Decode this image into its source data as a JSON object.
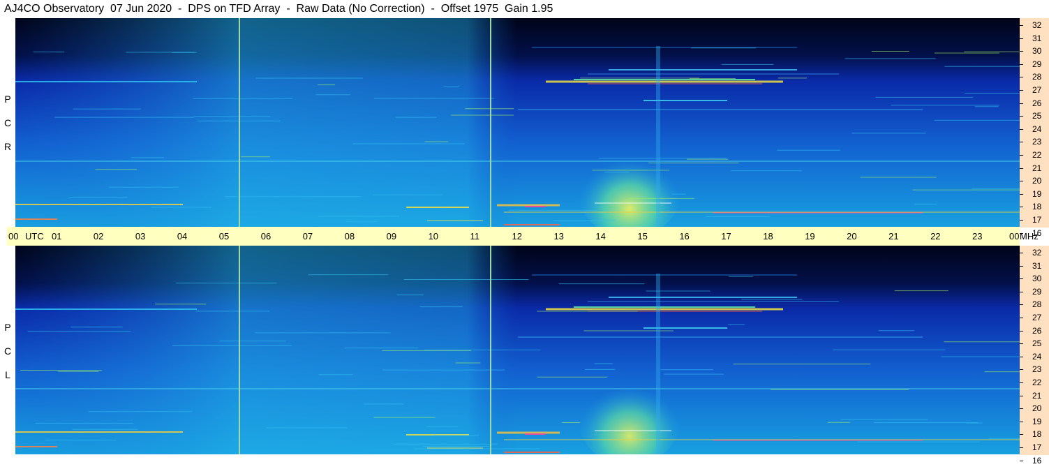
{
  "title": "AJ4CO Observatory  07 Jun 2020  -  DPS on TFD Array  -  Raw Data (No Correction)  -  Offset 1975  Gain 1.95",
  "time_axis": {
    "labels": [
      "00",
      "01",
      "02",
      "03",
      "04",
      "05",
      "06",
      "07",
      "08",
      "09",
      "10",
      "11",
      "12",
      "13",
      "14",
      "15",
      "16",
      "17",
      "18",
      "19",
      "20",
      "21",
      "22",
      "23",
      "00"
    ],
    "utc_label": "UTC",
    "mhz_label": "MHz"
  },
  "panels": [
    {
      "id": "rcp",
      "label_letters": [
        "P",
        "C",
        "R"
      ]
    },
    {
      "id": "lcp",
      "label_letters": [
        "P",
        "C",
        "L"
      ]
    }
  ],
  "freq_axis": {
    "labels": [
      "32",
      "31",
      "30",
      "29",
      "28",
      "27",
      "26",
      "25",
      "24",
      "23",
      "22",
      "21",
      "20",
      "19",
      "18",
      "17",
      "16"
    ]
  },
  "chart_data": {
    "type": "heatmap",
    "title": "AJ4CO Observatory  07 Jun 2020  -  DPS on TFD Array  -  Raw Data (No Correction)  -  Offset 1975  Gain 1.95",
    "xlabel": "UTC",
    "ylabel": "MHz",
    "xlim": [
      0,
      24
    ],
    "ylim": [
      16,
      32
    ],
    "series": [
      {
        "name": "RCP"
      },
      {
        "name": "LCP"
      }
    ],
    "markers_utc": [
      5.33,
      11.33
    ],
    "colors": {
      "background_dark": "#000820",
      "low": "#0a2aa8",
      "mid": "#1fb8e8",
      "high": "#f0f060",
      "peak": "#ff40a0"
    }
  }
}
